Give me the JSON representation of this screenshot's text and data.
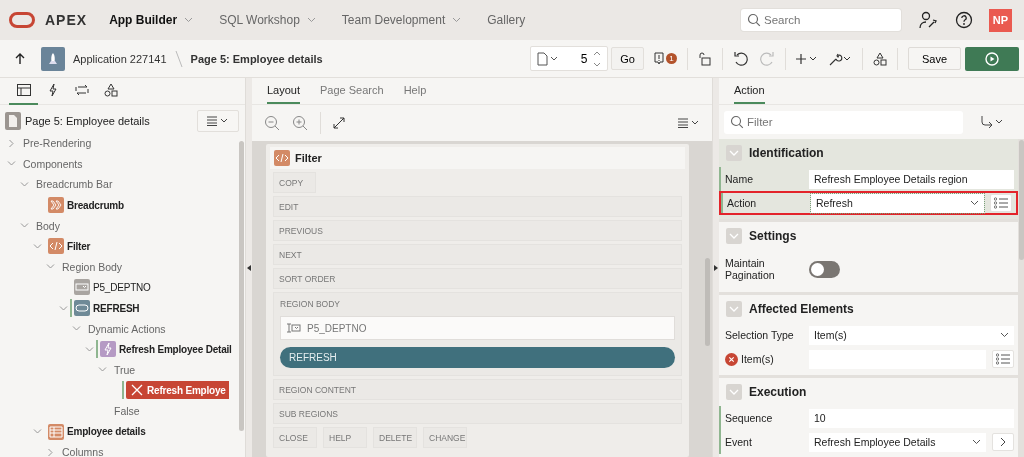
{
  "header": {
    "brand": "APEX",
    "nav": [
      {
        "label": "App Builder",
        "selected": true,
        "menu": true
      },
      {
        "label": "SQL Workshop",
        "selected": false,
        "menu": true
      },
      {
        "label": "Team Development",
        "selected": false,
        "menu": true
      },
      {
        "label": "Gallery",
        "selected": false,
        "menu": false
      }
    ],
    "search": {
      "placeholder": "Search"
    },
    "avatar": "NP"
  },
  "toolbar": {
    "application": "Application 227141",
    "page": "Page 5: Employee details",
    "page_number": "5",
    "go": "Go",
    "issues": "1",
    "redo_disabled": true,
    "save": "Save"
  },
  "left_panel": {
    "tabs": [
      {
        "kind": "rendering",
        "selected": true
      },
      {
        "kind": "dynamic-actions",
        "selected": false
      },
      {
        "kind": "processing",
        "selected": false
      },
      {
        "kind": "shared",
        "selected": false
      }
    ],
    "root": "Page 5: Employee details",
    "tree": [
      {
        "label": "Pre-Rendering",
        "kind": "group",
        "expanded": false,
        "selected": false,
        "changed": false
      },
      {
        "label": "Components",
        "kind": "group",
        "expanded": true,
        "selected": false,
        "changed": false,
        "children": [
          {
            "label": "Breadcrumb Bar",
            "kind": "group",
            "expanded": true,
            "selected": false,
            "changed": false,
            "children": [
              {
                "label": "Breadcrumb",
                "kind": "breadcrumb",
                "selected": false,
                "changed": false
              }
            ]
          },
          {
            "label": "Body",
            "kind": "group",
            "expanded": true,
            "selected": false,
            "changed": false,
            "children": [
              {
                "label": "Filter",
                "kind": "region",
                "expanded": true,
                "selected": false,
                "changed": false,
                "children": [
                  {
                    "label": "Region Body",
                    "kind": "group",
                    "expanded": true,
                    "selected": false,
                    "changed": false,
                    "children": [
                      {
                        "label": "P5_DEPTNO",
                        "kind": "item",
                        "selected": false,
                        "changed": false
                      },
                      {
                        "label": "REFRESH",
                        "kind": "button",
                        "expanded": true,
                        "selected": false,
                        "changed": true,
                        "children": [
                          {
                            "label": "Dynamic Actions",
                            "kind": "group",
                            "expanded": true,
                            "selected": false,
                            "changed": false,
                            "children": [
                              {
                                "label": "Refresh Employee Detail",
                                "kind": "dynamic-action",
                                "expanded": true,
                                "selected": false,
                                "changed": true,
                                "children": [
                                  {
                                    "label": "True",
                                    "kind": "group",
                                    "expanded": true,
                                    "selected": false,
                                    "changed": false,
                                    "children": [
                                      {
                                        "label": "Refresh Employe",
                                        "kind": "action",
                                        "selected": true,
                                        "changed": true
                                      }
                                    ]
                                  },
                                  {
                                    "label": "False",
                                    "kind": "group",
                                    "selected": false,
                                    "changed": false
                                  }
                                ]
                              }
                            ]
                          }
                        ]
                      }
                    ]
                  }
                ]
              },
              {
                "label": "Employee details",
                "kind": "report",
                "expanded": true,
                "selected": false,
                "changed": false,
                "children": [
                  {
                    "label": "Columns",
                    "kind": "group",
                    "expanded": false,
                    "selected": false,
                    "changed": false
                  }
                ]
              }
            ]
          }
        ]
      }
    ]
  },
  "layout_panel": {
    "tabs": [
      {
        "label": "Layout",
        "selected": true
      },
      {
        "label": "Page Search",
        "selected": false
      },
      {
        "label": "Help",
        "selected": false
      }
    ],
    "region": {
      "title": "Filter",
      "slots": [
        {
          "label": "COPY",
          "kind": "short"
        },
        {
          "label": "EDIT",
          "kind": "wide"
        },
        {
          "label": "PREVIOUS",
          "kind": "wide"
        },
        {
          "label": "NEXT",
          "kind": "wide"
        },
        {
          "label": "SORT ORDER",
          "kind": "wide"
        },
        {
          "label": "REGION BODY",
          "kind": "body",
          "items": [
            {
              "kind": "item",
              "label": "P5_DEPTNO"
            },
            {
              "kind": "button",
              "label": "REFRESH"
            }
          ]
        },
        {
          "label": "REGION CONTENT",
          "kind": "wide"
        },
        {
          "label": "SUB REGIONS",
          "kind": "wide"
        }
      ],
      "footer_slots": [
        "CLOSE",
        "HELP",
        "DELETE",
        "CHANGE"
      ]
    }
  },
  "property_panel": {
    "tabs": [
      {
        "label": "Action",
        "selected": true
      }
    ],
    "filter": {
      "placeholder": "Filter"
    },
    "sections": [
      {
        "title": "Identification",
        "current": true,
        "properties": [
          {
            "label": "Name",
            "kind": "text",
            "value": "Refresh Employee Details region",
            "required": true,
            "error": false,
            "highlighted": false
          },
          {
            "label": "Action",
            "kind": "select",
            "value": "Refresh",
            "required": true,
            "error": false,
            "highlighted": true,
            "side_button": {
              "kind": "list"
            }
          }
        ]
      },
      {
        "title": "Settings",
        "current": false,
        "properties": [
          {
            "label": "Maintain Pagination",
            "kind": "toggle",
            "on": false,
            "required": false,
            "error": false,
            "highlighted": false
          }
        ]
      },
      {
        "title": "Affected Elements",
        "current": false,
        "properties": [
          {
            "label": "Selection Type",
            "kind": "select",
            "value": "Item(s)",
            "required": false,
            "error": false,
            "highlighted": false
          },
          {
            "label": "Item(s)",
            "kind": "text",
            "required": false,
            "error": true,
            "highlighted": false,
            "side_button": {
              "kind": "list"
            }
          }
        ]
      },
      {
        "title": "Execution",
        "current": false,
        "properties": [
          {
            "label": "Sequence",
            "kind": "text",
            "value": "10",
            "required": true,
            "error": false,
            "highlighted": false
          },
          {
            "label": "Event",
            "kind": "select",
            "value": "Refresh Employee Details",
            "required": true,
            "error": false,
            "highlighted": false,
            "side_button": {
              "kind": "next"
            }
          }
        ]
      }
    ]
  }
}
